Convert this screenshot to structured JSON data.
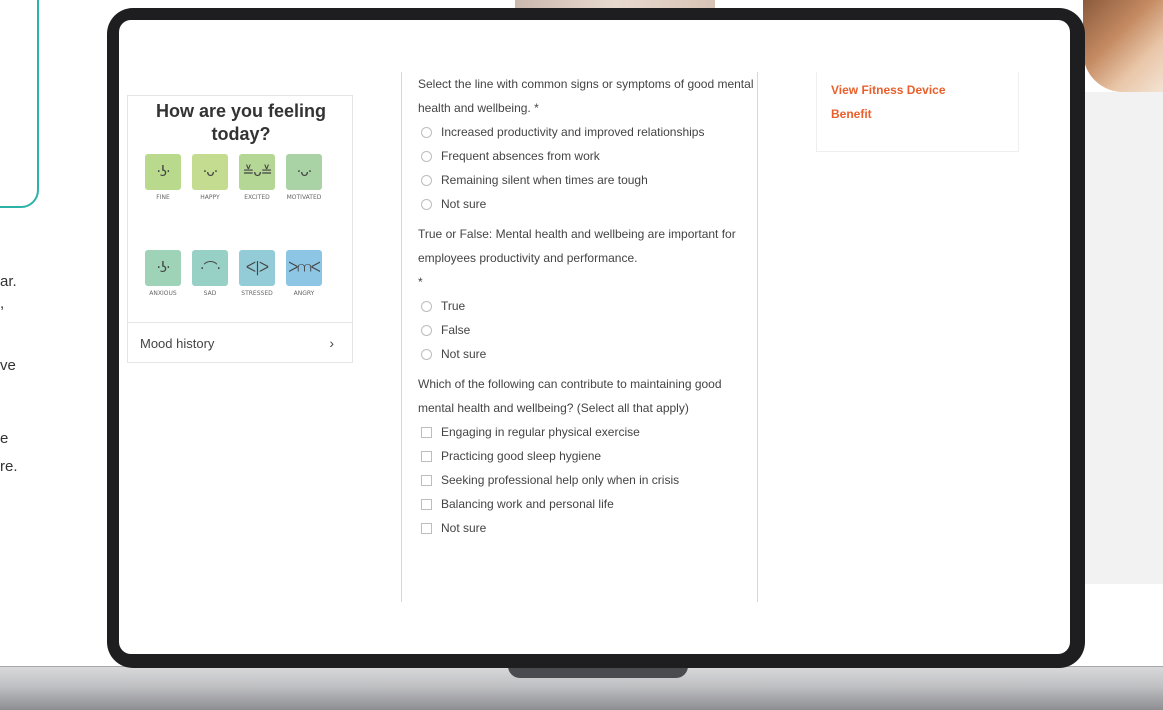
{
  "background": {
    "text_fragments": [
      "ar.",
      ",",
      "ve",
      "",
      "e",
      "re."
    ]
  },
  "mood": {
    "title": "How are you feeling today?",
    "row1": [
      {
        "label": "FINE",
        "glyph": "·ʖ·",
        "color": "#b9d98c"
      },
      {
        "label": "HAPPY",
        "glyph": "·ᴗ·",
        "color": "#c4dc8f"
      },
      {
        "label": "EXCITED",
        "glyph": "≚ᴗ≚",
        "color": "#b4d795"
      },
      {
        "label": "MOTIVATED",
        "glyph": "·ᴗ·",
        "color": "#a9d3a4"
      }
    ],
    "row2": [
      {
        "label": "ANXIOUS",
        "glyph": "·ʖ·",
        "color": "#9fd3b8"
      },
      {
        "label": "SAD",
        "glyph": "·⌒·",
        "color": "#97d0c4"
      },
      {
        "label": "STRESSED",
        "glyph": "ᐸ|ᐳ",
        "color": "#93cbd6"
      },
      {
        "label": "ANGRY",
        "glyph": "ᐳ⩋ᐸ",
        "color": "#8cc6e4"
      }
    ],
    "history_label": "Mood history",
    "history_chevron": "›"
  },
  "quiz": {
    "q1": {
      "text": "Select the line with common signs or symptoms of good mental health and wellbeing. *",
      "options": [
        "Increased productivity and improved relationships",
        "Frequent absences from work",
        "Remaining silent when times are tough",
        "Not sure"
      ]
    },
    "q2": {
      "text": "True or False: Mental health and wellbeing are important for employees productivity and performance.",
      "required": "*",
      "options": [
        "True",
        "False",
        "Not sure"
      ]
    },
    "q3": {
      "text": "Which of the following can contribute to maintaining good mental health and wellbeing? (Select all that apply)",
      "options": [
        "Engaging in regular physical exercise",
        "Practicing good sleep hygiene",
        "Seeking professional help only when in crisis",
        "Balancing work and personal life",
        "Not sure"
      ]
    }
  },
  "side": {
    "link_line1": "View Fitness Device",
    "link_line2": "Benefit"
  },
  "colors": {
    "accent_link": "#e8602c",
    "teal_border": "#2bb3aa"
  }
}
